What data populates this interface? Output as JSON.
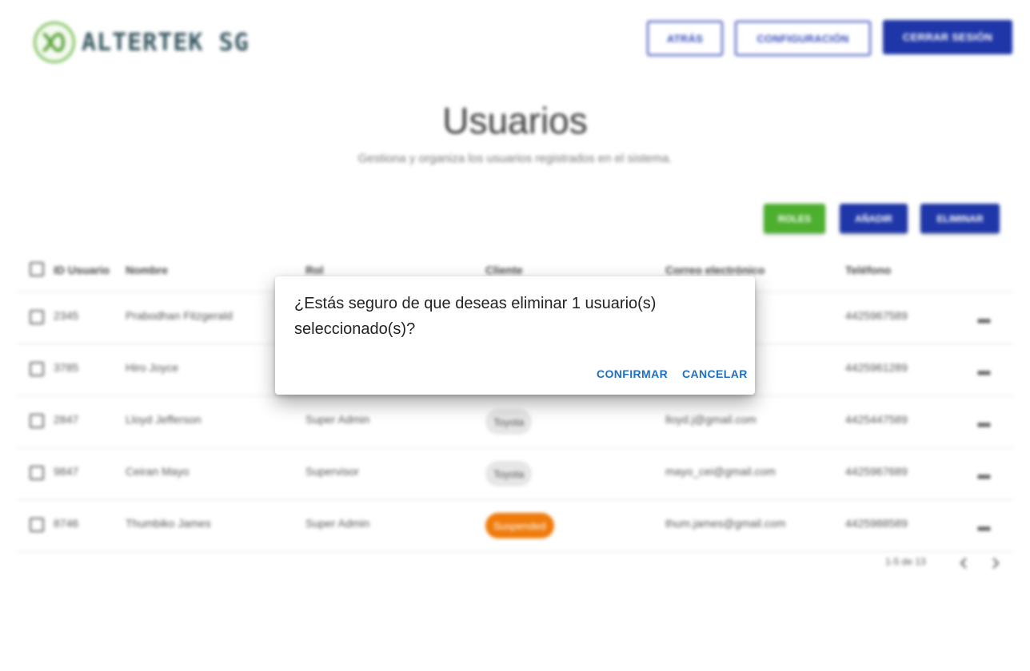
{
  "brand": {
    "name": "ALTERTEK SG",
    "accent": "#7cbf5a"
  },
  "header": {
    "back_label": "ATRÁS",
    "settings_label": "CONFIGURACIÓN",
    "logout_label": "CERRAR SESIÓN"
  },
  "page": {
    "title": "Usuarios",
    "subtitle": "Gestiona y organiza los usuarios registrados en el sistema."
  },
  "actions": {
    "roles_label": "ROLES",
    "add_label": "AÑADIR",
    "delete_label": "ELIMINAR",
    "colors": {
      "roles": "#4caf2e",
      "primary": "#1f36a8"
    }
  },
  "table": {
    "columns": [
      "ID Usuario",
      "Nombre",
      "Rol",
      "Cliente",
      "Correo electrónico",
      "Teléfono"
    ],
    "rows": [
      {
        "id": "2345",
        "name": "Prabodhan Fitzgerald",
        "role": "",
        "client": "",
        "email": "",
        "phone": "4425967589"
      },
      {
        "id": "3785",
        "name": "Hiro Joyce",
        "role": "",
        "client": "",
        "email": "",
        "phone": "4425961289"
      },
      {
        "id": "2847",
        "name": "Lloyd Jefferson",
        "role": "Super Admin",
        "client": "Toyota",
        "email": "lloyd.j@gmail.com",
        "phone": "4425447589"
      },
      {
        "id": "9847",
        "name": "Ceiran Mayo",
        "role": "Supervisor",
        "client": "Toyota",
        "email": "mayo_cei@gmail.com",
        "phone": "4425967689"
      },
      {
        "id": "8746",
        "name": "Thumbiko James",
        "role": "Super Admin",
        "client": "Suspended",
        "email": "thum.james@gmail.com",
        "phone": "4425988589"
      }
    ]
  },
  "pagination": {
    "range_label": "1-5 de 13"
  },
  "dialog": {
    "message": "¿Estás seguro de que deseas eliminar 1 usuario(s) seleccionado(s)?",
    "confirm_label": "CONFIRMAR",
    "cancel_label": "CANCELAR"
  }
}
